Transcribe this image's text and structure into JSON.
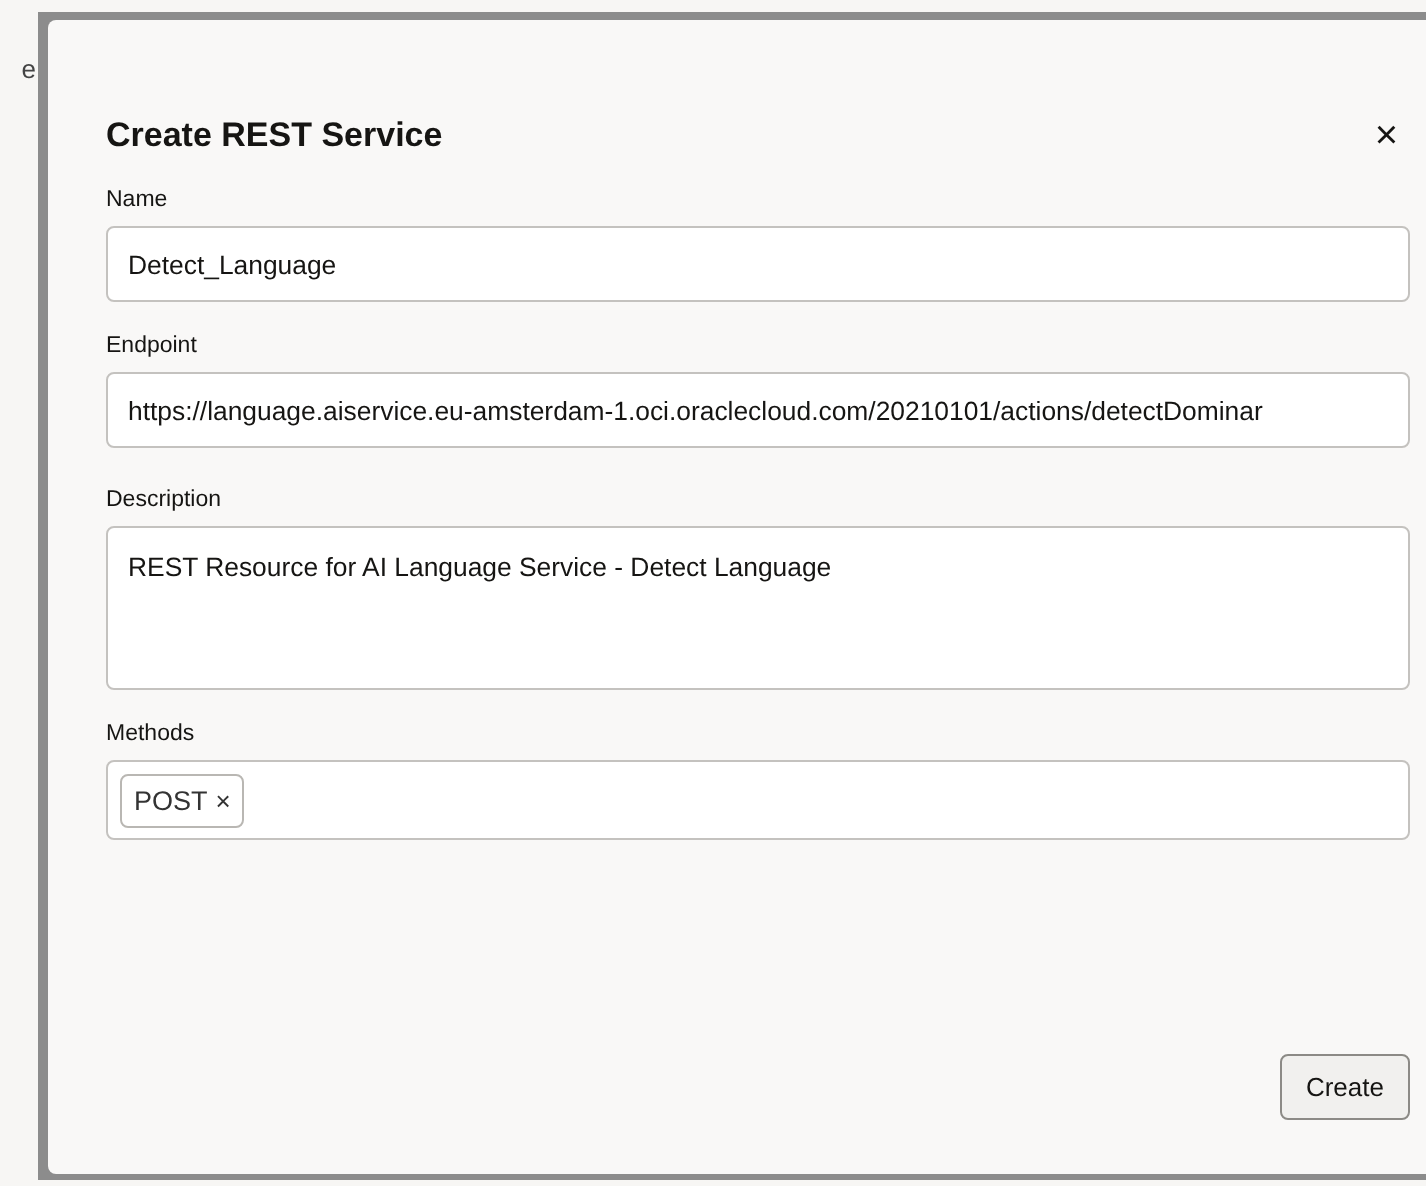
{
  "background_page": {
    "text_fragment": "e"
  },
  "dialog": {
    "title": "Create REST Service",
    "close": "×",
    "fields": [
      {
        "kind": "input",
        "label": "Name",
        "value": "Detect_Language"
      },
      {
        "kind": "input",
        "label": "Endpoint",
        "value": "https://language.aiservice.eu-amsterdam-1.oci.oraclecloud.com/20210101/actions/detectDominar"
      },
      {
        "kind": "textarea",
        "label": "Description",
        "value": "REST Resource for AI Language Service - Detect Language"
      },
      {
        "kind": "chips",
        "label": "Methods",
        "chips": [
          {
            "label": "POST",
            "remove": "×"
          }
        ]
      }
    ],
    "buttons": [
      "Create"
    ]
  }
}
